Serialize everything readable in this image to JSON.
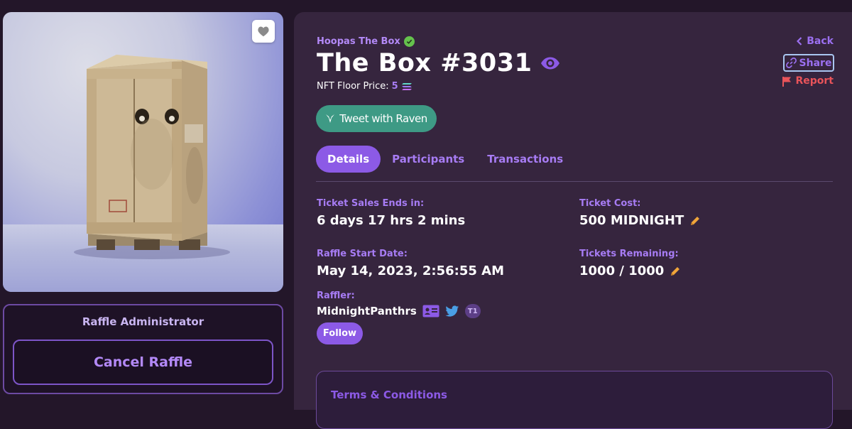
{
  "nft": {
    "collection": "Hoopas The Box",
    "title": "The Box #3031",
    "floor_label": "NFT Floor Price:",
    "floor_value": "5",
    "image_alt": "wooden crate"
  },
  "actions": {
    "back": "Back",
    "share": "Share",
    "report": "Report",
    "tweet": "Tweet with Raven",
    "follow": "Follow"
  },
  "tabs": [
    {
      "label": "Details",
      "active": true
    },
    {
      "label": "Participants",
      "active": false
    },
    {
      "label": "Transactions",
      "active": false
    }
  ],
  "details": {
    "ends_label": "Ticket Sales Ends in:",
    "ends_value": "6 days 17 hrs 2 mins",
    "cost_label": "Ticket Cost:",
    "cost_value": "500 MIDNIGHT",
    "start_label": "Raffle Start Date:",
    "start_value": "May 14, 2023, 2:56:55 AM",
    "remaining_label": "Tickets Remaining:",
    "remaining_value": "1000 / 1000",
    "raffler_label": "Raffler:",
    "raffler_name": "MidnightPanthrs",
    "raffler_badge": "T1"
  },
  "admin": {
    "title": "Raffle Administrator",
    "cancel": "Cancel Raffle"
  },
  "terms": {
    "title": "Terms & Conditions"
  },
  "colors": {
    "accent": "#8c5ae6",
    "tweet": "#3e9a85",
    "verified": "#65c24d",
    "report": "#e9545a",
    "edit": "#f0a53a"
  }
}
